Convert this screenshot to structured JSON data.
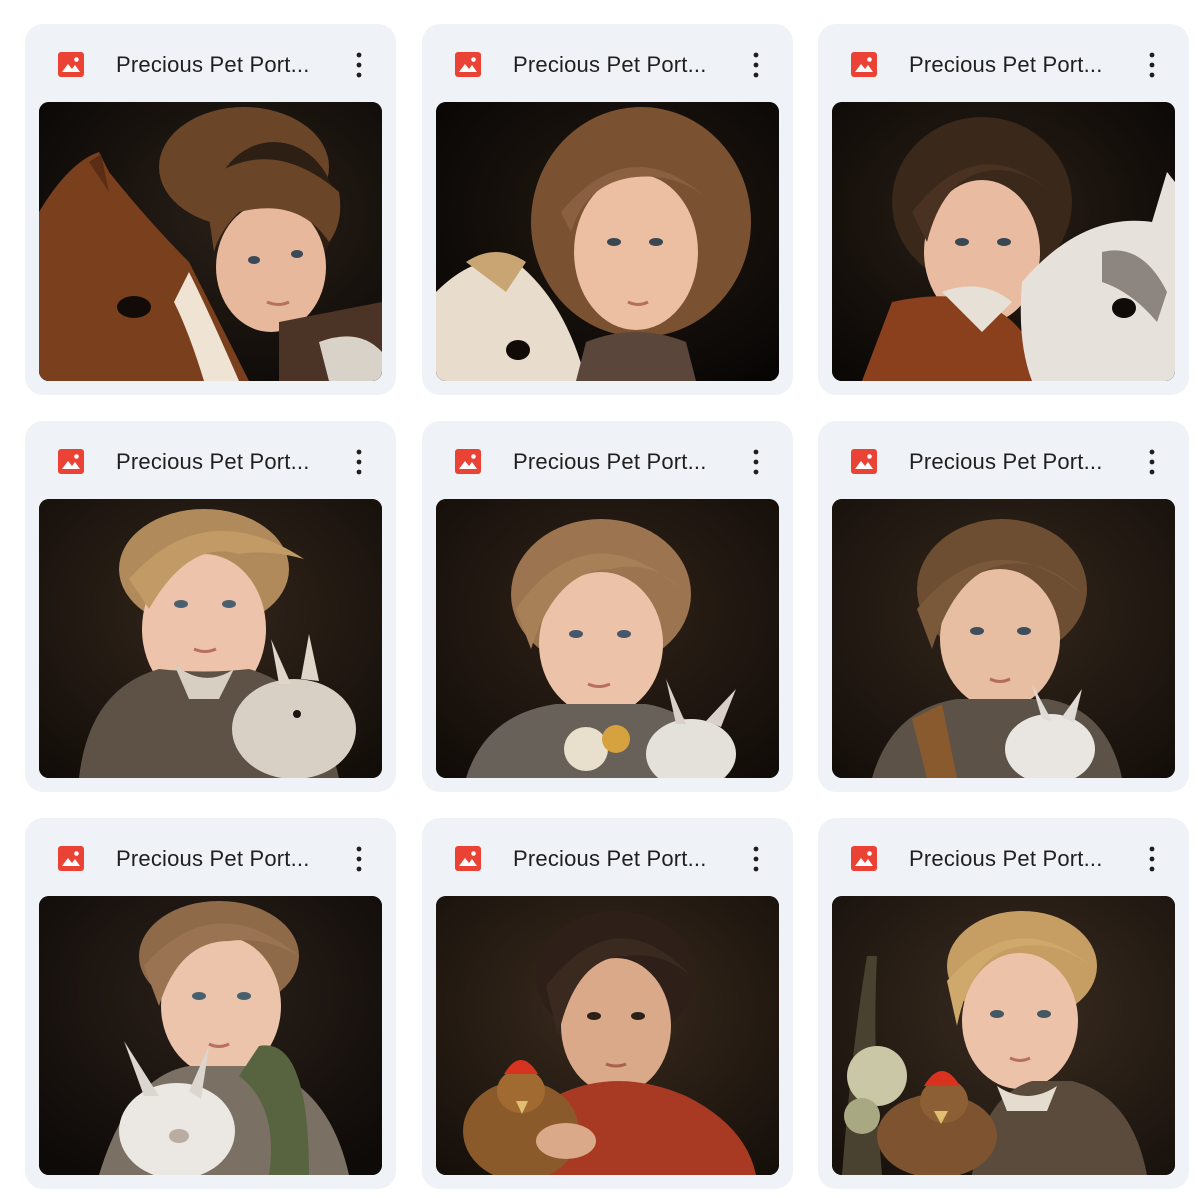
{
  "file_icon": "image-file-icon",
  "more_icon": "more-vertical-icon",
  "accent_red": "#ea4335",
  "card_bg": "#eff2f7",
  "files": [
    {
      "title": "Precious Pet Port...",
      "subject": "curly-haired child hugging brown and white pony",
      "animal": "pony"
    },
    {
      "title": "Precious Pet Port...",
      "subject": "long-haired child with cream pony",
      "animal": "pony"
    },
    {
      "title": "Precious Pet Port...",
      "subject": "child in vest with white pony",
      "animal": "pony"
    },
    {
      "title": "Precious Pet Port...",
      "subject": "blond boy holding white rabbit",
      "animal": "rabbit"
    },
    {
      "title": "Precious Pet Port...",
      "subject": "child with rabbit and flowers",
      "animal": "rabbit"
    },
    {
      "title": "Precious Pet Port...",
      "subject": "boy in vest with white rabbit",
      "animal": "rabbit"
    },
    {
      "title": "Precious Pet Port...",
      "subject": "boy in green scarf holding rabbit",
      "animal": "rabbit"
    },
    {
      "title": "Precious Pet Port...",
      "subject": "child in red scarf holding rooster",
      "animal": "rooster"
    },
    {
      "title": "Precious Pet Port...",
      "subject": "blond boy with rooster and flowers",
      "animal": "rooster"
    }
  ]
}
